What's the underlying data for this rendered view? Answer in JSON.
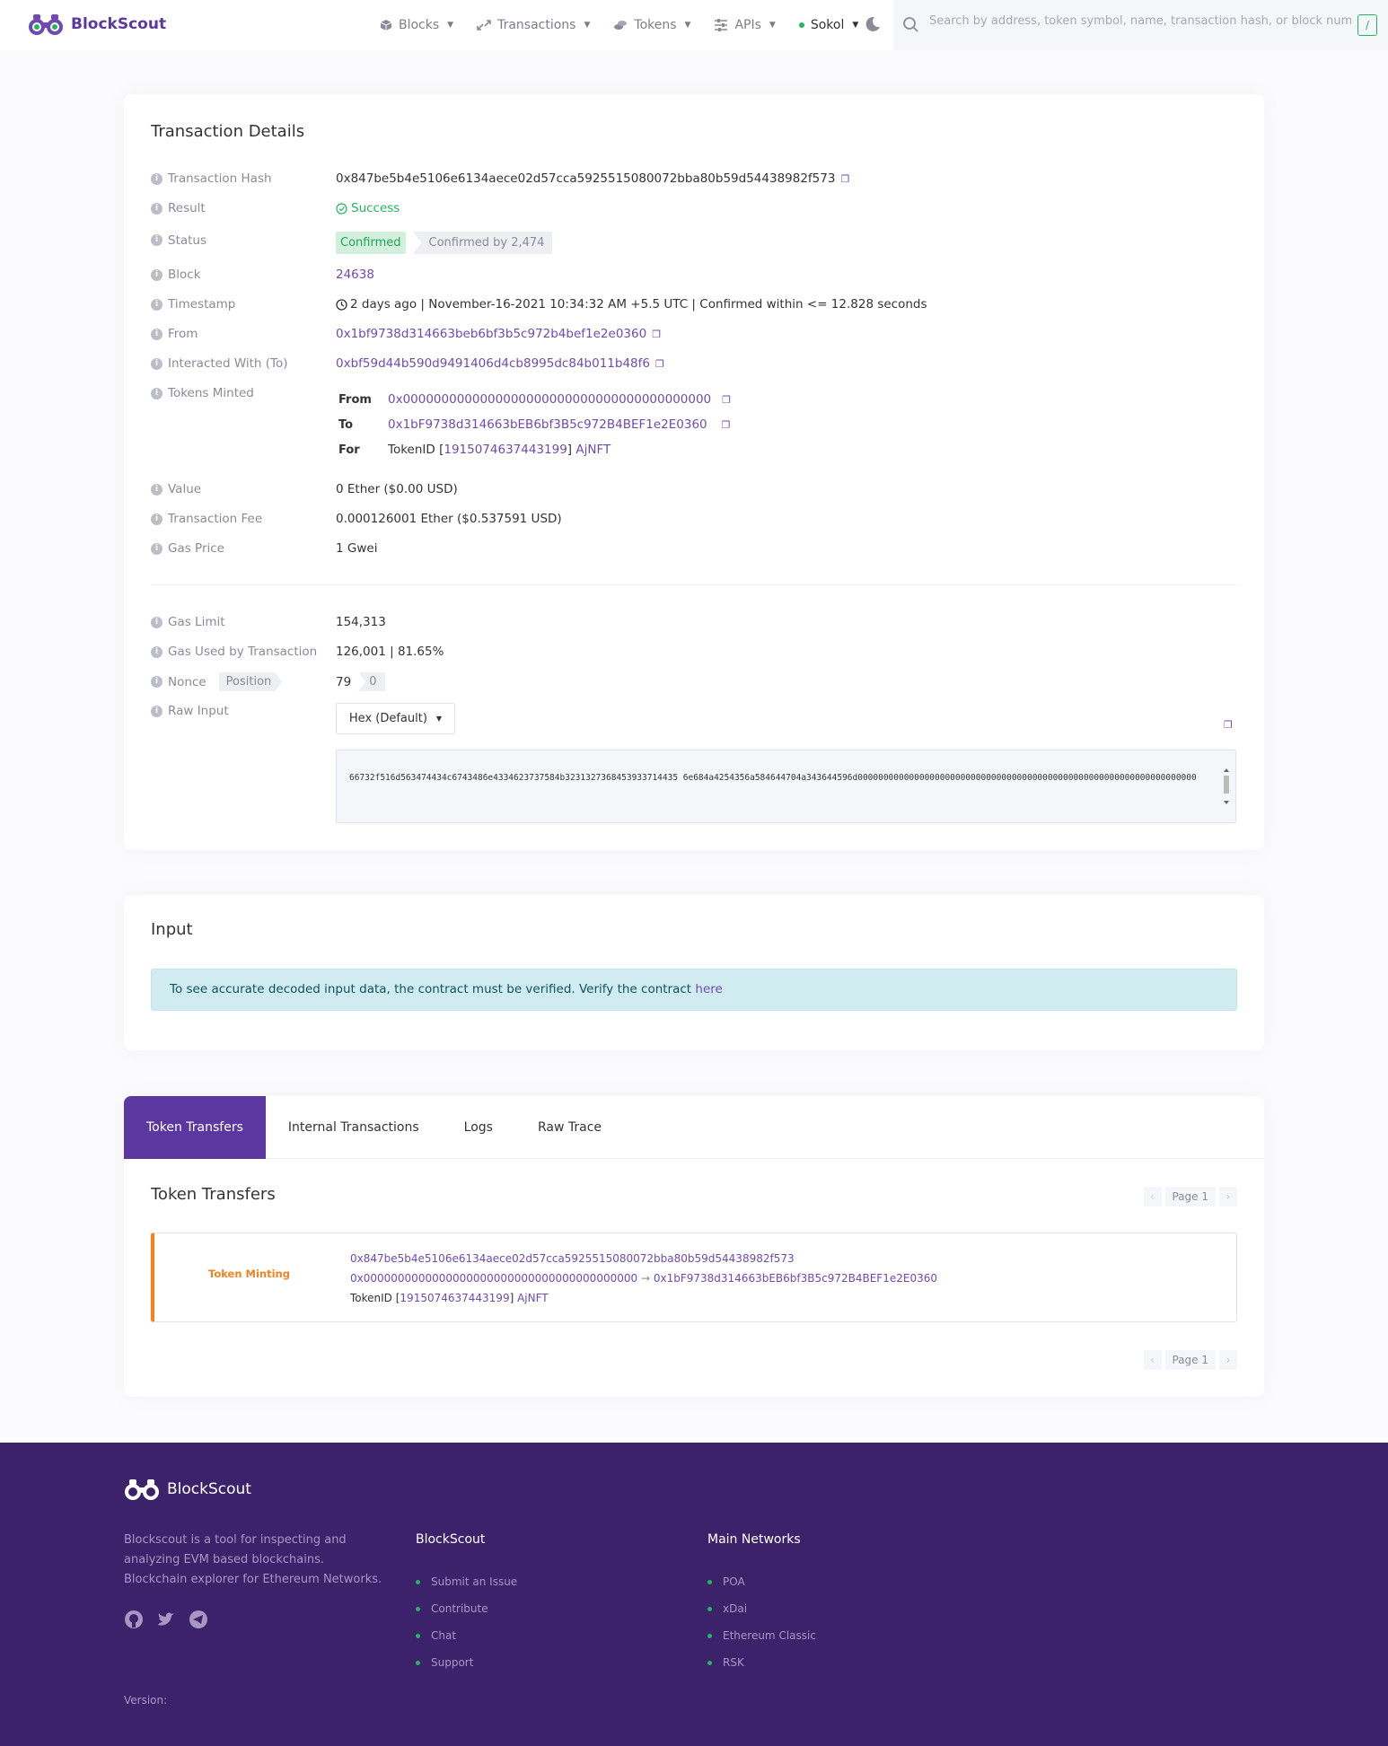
{
  "header": {
    "brand": "BlockScout",
    "nav": [
      {
        "label": "Blocks",
        "icon": "cube-icon"
      },
      {
        "label": "Transactions",
        "icon": "transactions-icon"
      },
      {
        "label": "Tokens",
        "icon": "tokens-icon"
      },
      {
        "label": "APIs",
        "icon": "sliders-icon"
      }
    ],
    "network": "Sokol",
    "search_placeholder": "Search by address, token symbol, name, transaction hash, or block number",
    "search_shortcut": "/"
  },
  "details": {
    "title": "Transaction Details",
    "labels": {
      "hash": "Transaction Hash",
      "result": "Result",
      "status": "Status",
      "block": "Block",
      "timestamp": "Timestamp",
      "from": "From",
      "to": "Interacted With (To)",
      "minted": "Tokens Minted",
      "value": "Value",
      "fee": "Transaction Fee",
      "gas_price": "Gas Price",
      "gas_limit": "Gas Limit",
      "gas_used": "Gas Used by Transaction",
      "nonce": "Nonce",
      "position": "Position",
      "raw_input": "Raw Input"
    },
    "hash": "0x847be5b4e5106e6134aece02d57cca5925515080072bba80b59d54438982f573",
    "result": "Success",
    "status": "Confirmed",
    "confirmations": "Confirmed by 2,474",
    "block": "24638",
    "timestamp": "2 days ago | November-16-2021 10:34:32 AM +5.5 UTC | Confirmed within <= 12.828 seconds",
    "from": "0x1bf9738d314663beb6bf3b5c972b4bef1e2e0360",
    "to": "0xbf59d44b590d9491406d4cb8995dc84b011b48f6",
    "minted": {
      "from_label": "From",
      "from": "0x0000000000000000000000000000000000000000",
      "to_label": "To",
      "to": "0x1bF9738d314663bEB6bf3B5c972B4BEF1e2E0360",
      "for_label": "For",
      "token_prefix": "TokenID [",
      "token_id": "1915074637443199",
      "token_suffix": "]",
      "token_name": "AjNFT"
    },
    "value": "0 Ether ($0.00 USD)",
    "fee": "0.000126001 Ether ($0.537591 USD)",
    "gas_price": "1 Gwei",
    "gas_limit": "154,313",
    "gas_used": "126,001 | 81.65%",
    "nonce": "79",
    "position": "0",
    "raw_format": "Hex (Default)",
    "raw_input": "66732f516d563474434c6743486e4334623737584b3231327368453933714435 6e684a4254356a584644704a343644596d000000000000000000000000000000000000000000000000000000000000000000"
  },
  "input": {
    "title": "Input",
    "alert": "To see accurate decoded input data, the contract must be verified. Verify the contract ",
    "alert_link": "here"
  },
  "tabs": [
    "Token Transfers",
    "Internal Transactions",
    "Logs",
    "Raw Trace"
  ],
  "transfers": {
    "title": "Token Transfers",
    "page": "Page 1",
    "item": {
      "type": "Token Minting",
      "hash": "0x847be5b4e5106e6134aece02d57cca5925515080072bba80b59d54438982f573",
      "from": "0x0000000000000000000000000000000000000000",
      "arrow": "→",
      "to": "0x1bF9738d314663bEB6bf3B5c972B4BEF1e2E0360",
      "token_prefix": "TokenID [",
      "token_id": "1915074637443199",
      "token_suffix": "]",
      "token_name": "AjNFT"
    }
  },
  "footer": {
    "brand": "BlockScout",
    "description": "Blockscout is a tool for inspecting and analyzing EVM based blockchains. Blockchain explorer for Ethereum Networks.",
    "col1_title": "BlockScout",
    "col1_links": [
      "Submit an Issue",
      "Contribute",
      "Chat",
      "Support"
    ],
    "col2_title": "Main Networks",
    "col2_links": [
      "POA",
      "xDai",
      "Ethereum Classic",
      "RSK"
    ],
    "version": "Version:"
  },
  "colors": {
    "brand": "#5b389f",
    "success": "#20b760",
    "footer": "#3c226a",
    "minting": "#f5821f"
  }
}
